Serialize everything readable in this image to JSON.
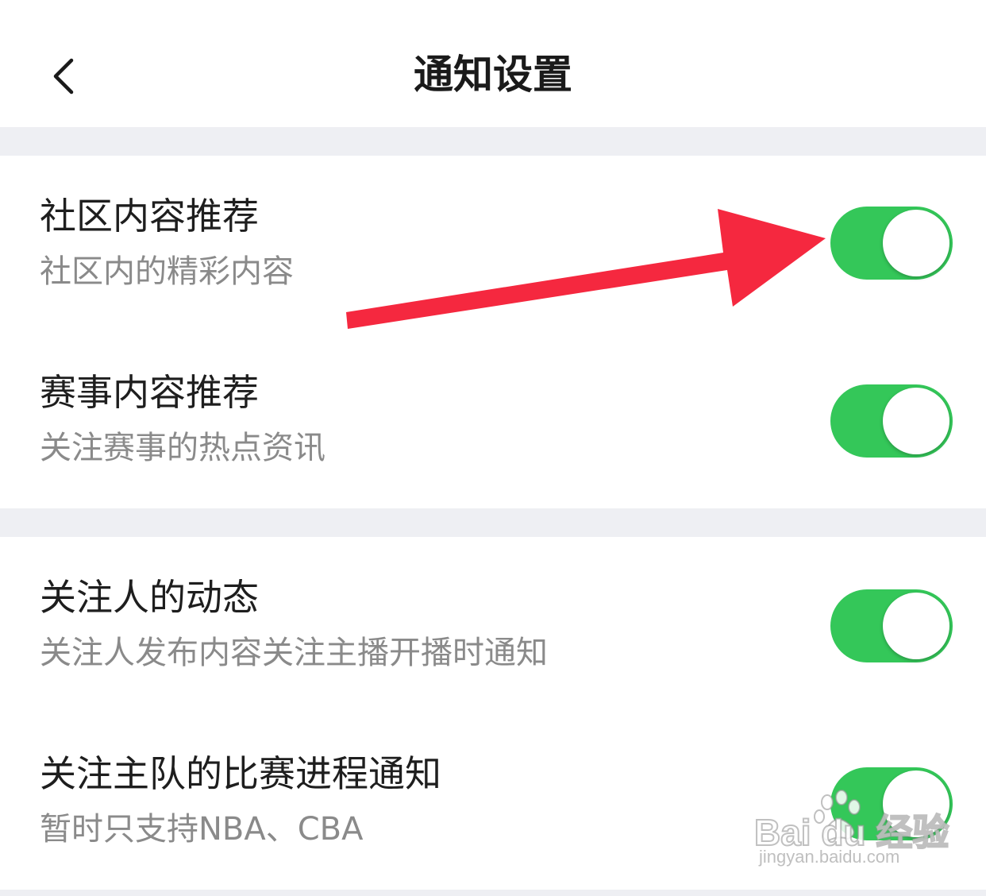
{
  "header": {
    "title": "通知设置",
    "back_icon": "chevron-left-icon"
  },
  "sections": [
    {
      "rows": [
        {
          "title": "社区内容推荐",
          "subtitle": "社区内的精彩内容",
          "enabled": true
        },
        {
          "title": "赛事内容推荐",
          "subtitle": "关注赛事的热点资讯",
          "enabled": true
        }
      ]
    },
    {
      "rows": [
        {
          "title": "关注人的动态",
          "subtitle": "关注人发布内容关注主播开播时通知",
          "enabled": true
        },
        {
          "title": "关注主队的比赛进程通知",
          "subtitle": "暂时只支持NBA、CBA",
          "enabled": true
        }
      ]
    }
  ],
  "annotation": {
    "icon": "red-arrow-icon",
    "color": "#f5283f"
  },
  "watermark": {
    "logo": "Bai du 经验",
    "url": "jingyan.baidu.com"
  },
  "colors": {
    "toggle_on": "#34c759",
    "section_gap": "#eeeff3",
    "title_text": "#1e1e1e",
    "subtitle_text": "#8a8a8a"
  }
}
